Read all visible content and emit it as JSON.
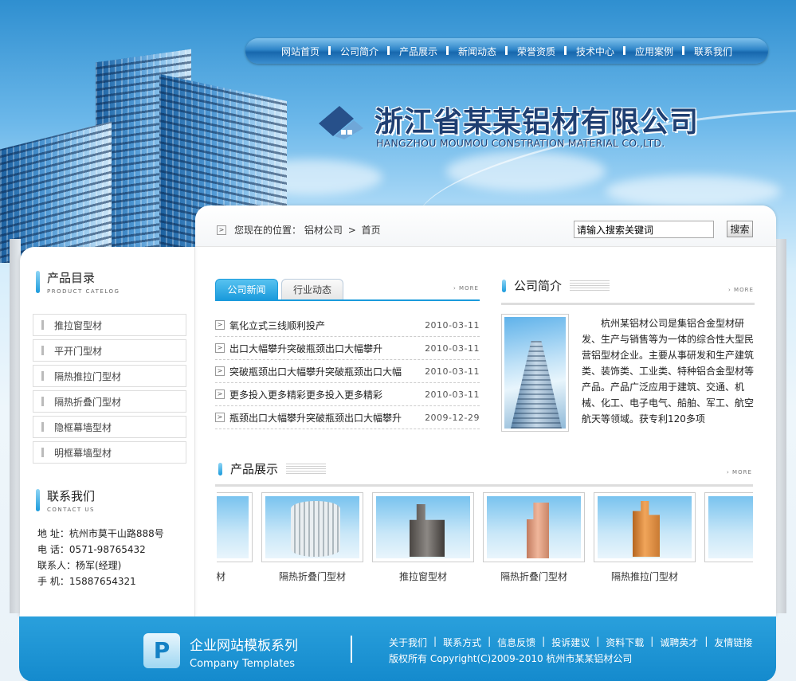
{
  "nav": {
    "items": [
      "网站首页",
      "公司简介",
      "产品展示",
      "新闻动态",
      "荣誉资质",
      "技术中心",
      "应用案例",
      "联系我们"
    ]
  },
  "logo": {
    "name_cn": "浙江省某某铝材有限公司",
    "name_en": "HANGZHOU MOUMOU CONSTRATION MATERIAL CO.,LTD."
  },
  "breadcrumb": {
    "prefix": "您现在的位置：",
    "path1": "铝材公司",
    "sep": ">",
    "path2": "首页"
  },
  "search": {
    "value": "请输入搜索关键词",
    "button": "搜索"
  },
  "sidebar": {
    "catalog_title": "产品目录",
    "catalog_title_en": "PRODUCT CATELOG",
    "categories": [
      "推拉窗型材",
      "平开门型材",
      "隔热推拉门型材",
      "隔热折叠门型材",
      "隐框幕墙型材",
      "明框幕墙型材"
    ],
    "contact_title": "联系我们",
    "contact_title_en": "CONTACT US",
    "contact": {
      "address": "地 址：杭州市莫干山路888号",
      "phone": "电 话：0571-98765432",
      "person": "联系人：杨军(经理)",
      "mobile": "手 机：15887654321"
    }
  },
  "news": {
    "tab_active": "公司新闻",
    "tab_inactive": "行业动态",
    "more": "› MORE",
    "items": [
      {
        "title": "氧化立式三线顺利投产",
        "date": "2010-03-11"
      },
      {
        "title": "出口大幅攀升突破瓶颈出口大幅攀升",
        "date": "2010-03-11"
      },
      {
        "title": "突破瓶颈出口大幅攀升突破瓶颈出口大幅",
        "date": "2010-03-11"
      },
      {
        "title": "更多投入更多精彩更多投入更多精彩",
        "date": "2010-03-11"
      },
      {
        "title": "瓶颈出口大幅攀升突破瓶颈出口大幅攀升",
        "date": "2009-12-29"
      }
    ]
  },
  "about": {
    "title": "公司简介",
    "more": "› MORE",
    "text": "杭州某铝材公司是集铝合金型材研发、生产与销售等为一体的综合性大型民营铝型材企业。主要从事研发和生产建筑类、装饰类、工业类、特种铝合金型材等产品。产品广泛应用于建筑、交通、机械、化工、电子电气、船舶、军工、航空航天等领域。获专利120多项"
  },
  "products": {
    "title": "产品展示",
    "more": "› MORE",
    "items": [
      {
        "name": "平开门型材",
        "shape": "orange"
      },
      {
        "name": "隔热折叠门型材",
        "shape": "cylinder"
      },
      {
        "name": "推拉窗型材",
        "shape": "dark"
      },
      {
        "name": "隔热折叠门型材",
        "shape": "pink"
      },
      {
        "name": "隔热推拉门型材",
        "shape": "orange"
      }
    ]
  },
  "footer": {
    "logo_letter": "P",
    "brand_cn": "企业网站模板系列",
    "brand_en": "Company Templates",
    "links": [
      "关于我们",
      "联系方式",
      "信息反馈",
      "投诉建议",
      "资料下载",
      "诚聘英才",
      "友情链接"
    ],
    "copyright": "版权所有  Copyright(C)2009-2010 杭州市某某铝材公司"
  },
  "colors": {
    "accent": "#1b9bdc",
    "footer": "#148acd",
    "logo_text": "#1f3f72"
  }
}
